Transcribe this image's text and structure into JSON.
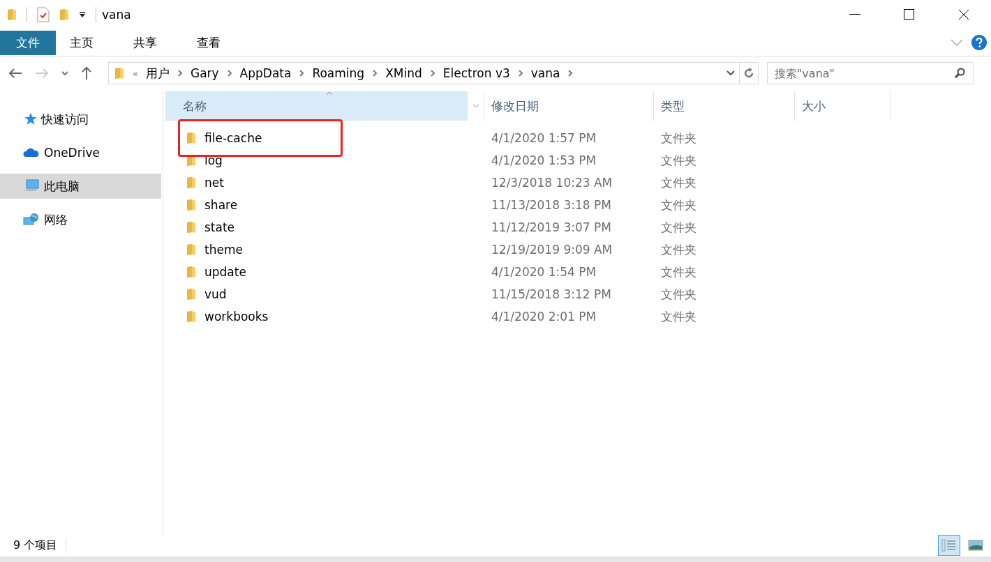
{
  "window": {
    "title": "vana"
  },
  "ribbon": {
    "tabs": [
      {
        "label": "文件",
        "kind": "file"
      },
      {
        "label": "主页",
        "kind": "tab"
      },
      {
        "label": "共享",
        "kind": "tab"
      },
      {
        "label": "查看",
        "kind": "tab"
      }
    ]
  },
  "address": {
    "overflow": "«",
    "path": [
      "用户",
      "Gary",
      "AppData",
      "Roaming",
      "XMind",
      "Electron v3",
      "vana"
    ]
  },
  "search": {
    "placeholder": "搜索\"vana\""
  },
  "sidebar": {
    "items": [
      {
        "label": "快速访问",
        "kind": "star",
        "selected": false
      },
      {
        "label": "OneDrive",
        "kind": "cloud",
        "selected": false
      },
      {
        "label": "此电脑",
        "kind": "pc",
        "selected": true
      },
      {
        "label": "网络",
        "kind": "network",
        "selected": false
      }
    ]
  },
  "table": {
    "columns": [
      {
        "label": "名称",
        "sorted": true
      },
      {
        "label": "修改日期",
        "sorted": false
      },
      {
        "label": "类型",
        "sorted": false
      },
      {
        "label": "大小",
        "sorted": false
      }
    ],
    "rows": [
      {
        "name": "file-cache",
        "date": "4/1/2020 1:57 PM",
        "type": "文件夹",
        "highlighted": true
      },
      {
        "name": "log",
        "date": "4/1/2020 1:53 PM",
        "type": "文件夹",
        "highlighted": false
      },
      {
        "name": "net",
        "date": "12/3/2018 10:23 AM",
        "type": "文件夹",
        "highlighted": false
      },
      {
        "name": "share",
        "date": "11/13/2018 3:18 PM",
        "type": "文件夹",
        "highlighted": false
      },
      {
        "name": "state",
        "date": "11/12/2019 3:07 PM",
        "type": "文件夹",
        "highlighted": false
      },
      {
        "name": "theme",
        "date": "12/19/2019 9:09 AM",
        "type": "文件夹",
        "highlighted": false
      },
      {
        "name": "update",
        "date": "4/1/2020 1:54 PM",
        "type": "文件夹",
        "highlighted": false
      },
      {
        "name": "vud",
        "date": "11/15/2018 3:12 PM",
        "type": "文件夹",
        "highlighted": false
      },
      {
        "name": "workbooks",
        "date": "4/1/2020 2:01 PM",
        "type": "文件夹",
        "highlighted": false
      }
    ]
  },
  "status_bar": {
    "count": "9 个项目",
    "views": [
      {
        "kind": "details",
        "selected": true
      },
      {
        "kind": "large",
        "selected": false
      }
    ]
  }
}
